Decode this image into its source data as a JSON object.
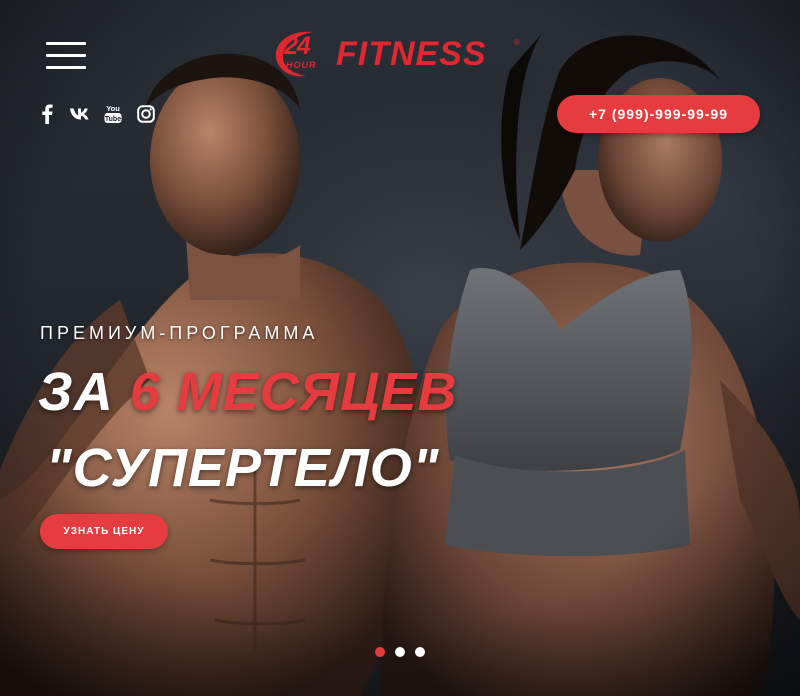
{
  "header": {
    "logo": {
      "number": "24",
      "hour": "HOUR",
      "word": "FITNESS",
      "mark": "®"
    },
    "menu_icon": "hamburger-icon",
    "phone": "+7 (999)-999-99-99"
  },
  "socials": [
    {
      "name": "facebook",
      "icon": "facebook-icon",
      "glyph": "f"
    },
    {
      "name": "vk",
      "icon": "vk-icon",
      "glyph": "vk"
    },
    {
      "name": "youtube",
      "icon": "youtube-icon",
      "glyph": "You Tube"
    },
    {
      "name": "instagram",
      "icon": "instagram-icon",
      "glyph": ""
    }
  ],
  "hero": {
    "eyebrow": "ПРЕМИУМ-ПРОГРАММА",
    "headline_white": "ЗА",
    "headline_red": "6 МЕСЯЦЕВ",
    "headline_line2": "\"СУПЕРТЕЛО\"",
    "cta": "УЗНАТЬ ЦЕНУ"
  },
  "slider": {
    "count": 3,
    "active_index": 0
  },
  "colors": {
    "accent": "#e63c3f",
    "logo": "#e1272f",
    "text": "#ffffff",
    "background": "#22262d"
  }
}
